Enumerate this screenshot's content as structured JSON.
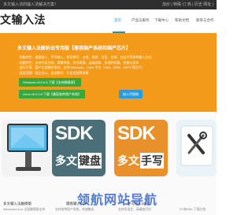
{
  "topbar": {
    "left_text": "多文输入法的输入法解决方案！",
    "right_text": "加价 | 特殊 订 热 | 历史 网址 |"
  },
  "navbar": {
    "logo": "文输入法",
    "items": [
      {
        "label": "首页",
        "active": true
      },
      {
        "label": "产品与服务",
        "active": false
      },
      {
        "label": "下载中心",
        "active": false
      },
      {
        "label": "帮助文档",
        "active": false
      },
      {
        "label": "联系与合作",
        "active": false
      }
    ]
  },
  "hero": {
    "title": "多文输入法解析出专用版【兼容国产系统和国产芯片】",
    "desc_lines": [
      "· 功能特色：键盘输入、手写输入、拼音拼写、五笔、双拼、注音、仓颉、自定义等多种输入方式",
      "· 功能特色：支持中英日韩、简繁转换、符号表情、云端词库、多语种切换、完善与发布",
      "· 运行环境：国产主流操作系统，支持 Windows、Linux 平台（X86、ARM、MIPS 等芯片）",
      "· 适用范围：政企办公、信创替代、行业定制等场景"
    ],
    "buttons": {
      "windows": "Windows v5.0.0.5 下载【支持触摸屏】",
      "linux": "Linux v5.0.0.5 下载【兼容各种国产系统】",
      "join": "加入代理商"
    }
  },
  "products": [
    {
      "label": "多文输入法触摸版",
      "sub": "Windows/Linux 全面触摸屏支持"
    },
    {
      "label": "键盘输入SDK",
      "sub": "支持各种国产系统，快速集成"
    },
    {
      "label": "手写输入SDK",
      "sub": "支持多语言，高精度识别"
    },
    {
      "label": "",
      "sub": "PC和SDK 下载文档"
    }
  ],
  "sdk_cards": {
    "sdk": "SDK",
    "card2_cn_a": "多文",
    "card2_cn_b": "键盘",
    "card3_cn_a": "多文",
    "card3_cn_b": "手写"
  },
  "watermark": "领航网站导航",
  "colors": {
    "hero_bg": "#f39a1b",
    "nav_active": "#1a8ed8",
    "btn_green": "#35a93c",
    "btn_blue": "#2b9be0",
    "card_sdk_teal": "#4a6f78",
    "card_sdk_orange": "#e8912a"
  }
}
